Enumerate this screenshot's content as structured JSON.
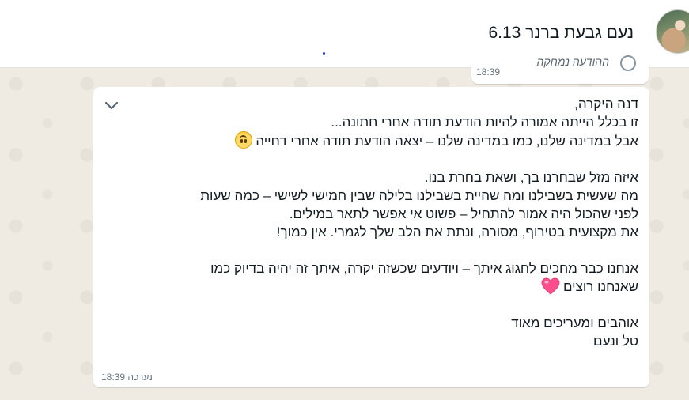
{
  "header": {
    "contact_name": "נעם גבעת ברנר 6.13"
  },
  "previous_message": {
    "text": "ההודעה נמחקה",
    "time": "18:39"
  },
  "message": {
    "lines": [
      "דנה היקרה,",
      "זו בכלל הייתה אמורה להיות הודעת תודה אחרי חתונה...",
      "אבל במדינה שלנו, כמו במדינה שלנו – יצאה הודעת תודה אחרי דחייה",
      "",
      "איזה מזל שבחרנו בך, ושאת בחרת בנו.",
      "מה שעשית בשבילנו ומה שהיית בשבילנו בלילה שבין חמישי לשישי – כמה שעות",
      "לפני שהכול היה אמור להתחיל – פשוט אי אפשר לתאר במילים.",
      "את מקצועית בטירוף, מסורה, ונתת את הלב שלך לגמרי. אין כמוך!",
      "",
      "אנחנו כבר מחכים לחגוג איתך – ויודעים שכשזה יקרה, איתך זה יהיה בדיוק כמו",
      "שאנחנו רוצים",
      "",
      "אוהבים ומעריכים מאוד",
      "טל ונעם"
    ],
    "emoji_line3": "upside-down-face",
    "emoji_line11": "pink-heart",
    "edited_label": "נערכה",
    "time": "18:39"
  },
  "icons": {
    "chevron": "chevron-down-icon",
    "avatar": "contact-avatar"
  },
  "colors": {
    "header_bg": "#ffffff",
    "chat_bg": "#efeae2",
    "bubble_bg": "#ffffff",
    "text": "#111b21",
    "meta": "#667781",
    "heart": "#ff4f8b"
  }
}
